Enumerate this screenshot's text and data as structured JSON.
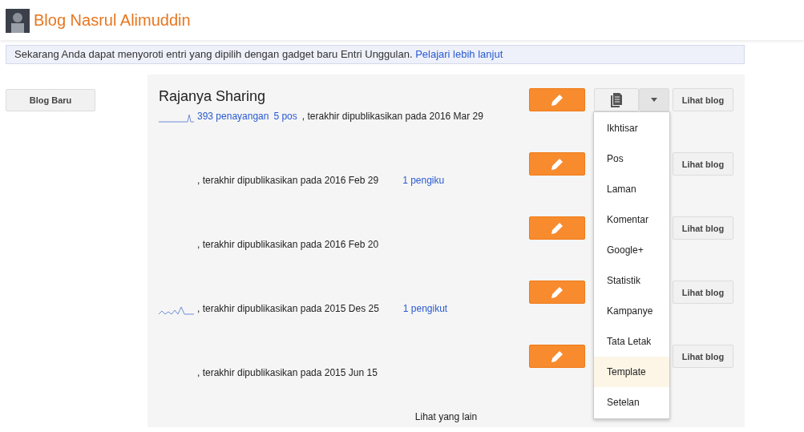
{
  "header": {
    "title": "Blog Nasrul Alimuddin"
  },
  "notice": {
    "text": "Sekarang Anda dapat menyoroti entri yang dipilih dengan gadget baru Entri Unggulan.",
    "link": "Pelajari lebih lanjut"
  },
  "new_blog_button": "Blog Baru",
  "blogs": [
    {
      "title": "Rajanya Sharing",
      "sparkline": true,
      "views": "393 penayangan",
      "posts": "5 pos",
      "published": ", terakhir dipublikasikan pada 2016 Mar 29",
      "view_button": "Lihat blog"
    },
    {
      "published": ", terakhir dipublikasikan pada 2016 Feb 29",
      "followers": "1 pengiku",
      "view_button": "Lihat blog"
    },
    {
      "published": ", terakhir dipublikasikan pada 2016 Feb 20",
      "view_button": "Lihat blog"
    },
    {
      "sparkline": true,
      "published": ", terakhir dipublikasikan pada 2015 Des 25",
      "followers": "1 pengikut",
      "view_button": "Lihat blog"
    },
    {
      "published": ", terakhir dipublikasikan pada 2015 Jun 15",
      "view_button": "Lihat blog"
    }
  ],
  "menu": [
    {
      "label": "Ikhtisar",
      "selected": false
    },
    {
      "label": "Pos",
      "selected": false
    },
    {
      "label": "Laman",
      "selected": false
    },
    {
      "label": "Komentar",
      "selected": false
    },
    {
      "label": "Google+",
      "selected": false
    },
    {
      "label": "Statistik",
      "selected": false
    },
    {
      "label": "Kampanye",
      "selected": false
    },
    {
      "label": "Tata Letak",
      "selected": false
    },
    {
      "label": "Template",
      "selected": true
    },
    {
      "label": "Setelan",
      "selected": false
    }
  ],
  "more_link": "Lihat yang lain"
}
